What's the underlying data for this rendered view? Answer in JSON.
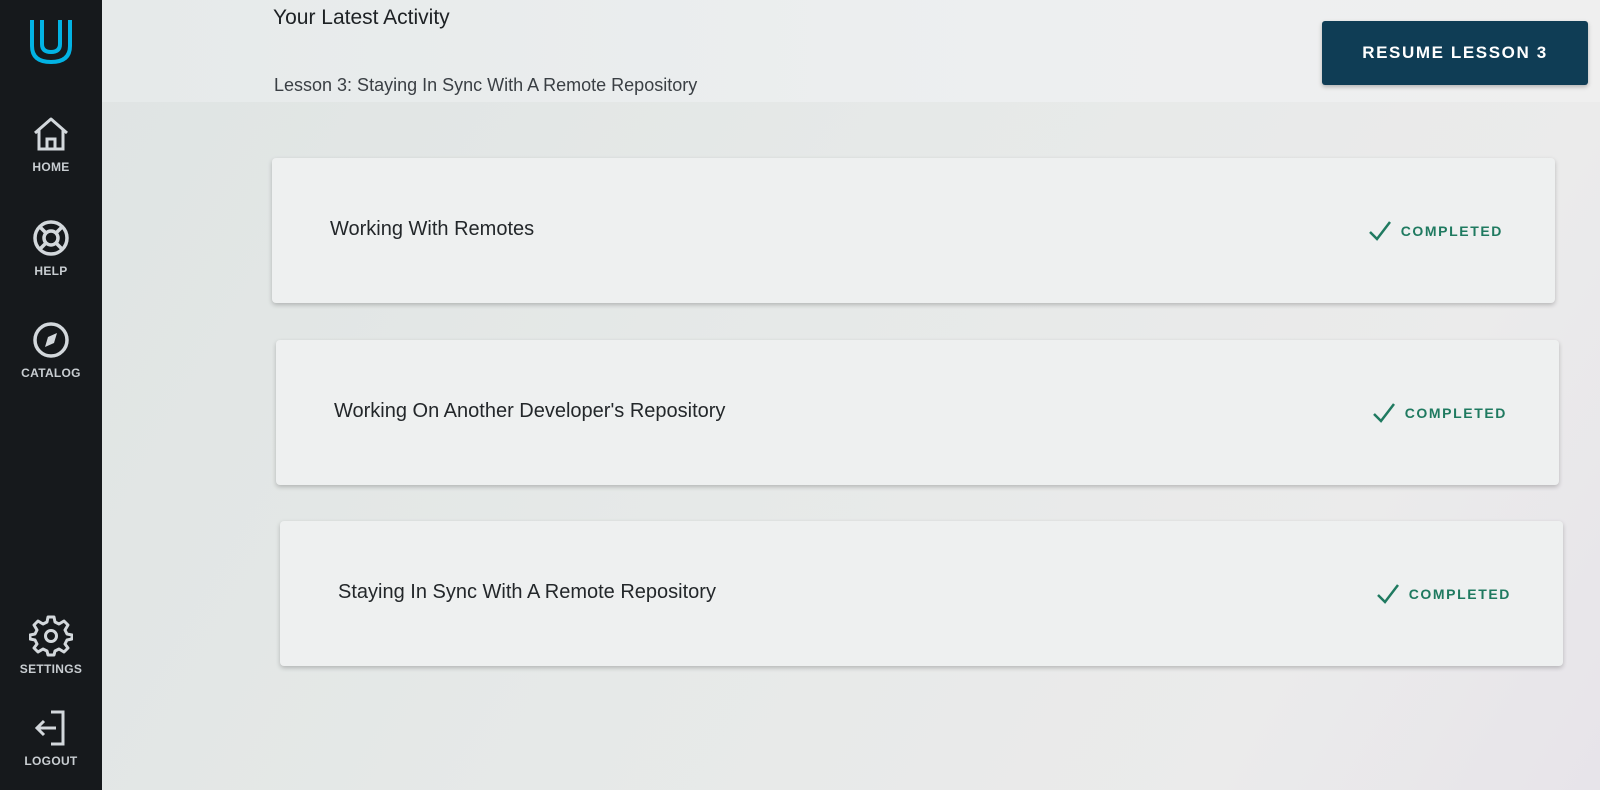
{
  "sidebar": {
    "logo_icon": "udacity-logo-icon",
    "items": [
      {
        "label": "HOME",
        "icon": "home-icon"
      },
      {
        "label": "HELP",
        "icon": "lifebuoy-icon"
      },
      {
        "label": "CATALOG",
        "icon": "compass-icon"
      },
      {
        "label": "SETTINGS",
        "icon": "gear-icon"
      },
      {
        "label": "LOGOUT",
        "icon": "logout-icon"
      }
    ]
  },
  "header": {
    "title": "Your Latest Activity",
    "lesson": "Lesson 3: Staying In Sync With A Remote Repository",
    "resume_label": "RESUME LESSON 3"
  },
  "concepts": [
    {
      "title": "Working With Remotes",
      "status": "COMPLETED"
    },
    {
      "title": "Working On Another Developer's Repository",
      "status": "COMPLETED"
    },
    {
      "title": "Staying In Sync With A Remote Repository",
      "status": "COMPLETED"
    }
  ],
  "colors": {
    "accent": "#0f3d55",
    "completed": "#1f7a60",
    "sidebar": "#16191c",
    "logo": "#02b3e4"
  }
}
